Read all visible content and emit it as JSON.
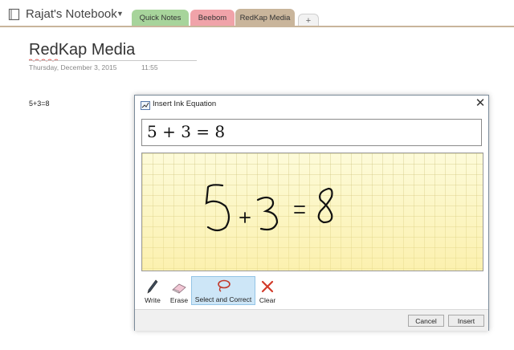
{
  "notebook": {
    "title": "Rajat's Notebook",
    "caret": "▼",
    "tabs": [
      {
        "label": "Quick Notes",
        "color": "#a7d49b"
      },
      {
        "label": "Beebom",
        "color": "#f0a3a9"
      },
      {
        "label": "RedKap Media",
        "color": "#c9b59b",
        "active": true
      }
    ],
    "add_tab_label": "+"
  },
  "page": {
    "title": "RedKap Media",
    "date": "Thursday, December 3, 2015",
    "time": "11:55",
    "body_text": "5+3=8"
  },
  "dialog": {
    "title": "Insert Ink Equation",
    "close_glyph": "✕",
    "equation": "5 + 3 = 8",
    "tools": [
      {
        "label": "Write",
        "icon": "pen-icon"
      },
      {
        "label": "Erase",
        "icon": "eraser-icon"
      },
      {
        "label": "Select and Correct",
        "icon": "lasso-icon",
        "selected": true
      },
      {
        "label": "Clear",
        "icon": "clear-x-icon"
      }
    ],
    "buttons": {
      "cancel": "Cancel",
      "insert": "Insert"
    }
  },
  "colors": {
    "tab_border": "#c9b59b",
    "ink_background": "#fdfbd9",
    "selected_tool": "#cde6f7",
    "clear_icon": "#d23a2a"
  }
}
